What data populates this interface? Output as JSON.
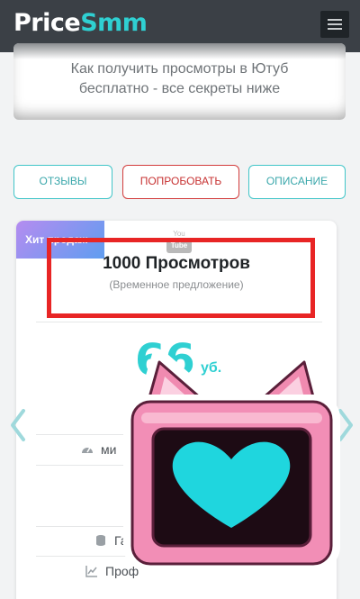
{
  "header": {
    "logo_part1": "Price",
    "logo_part2": "Smm"
  },
  "info": {
    "line1": "Как получить просмотры в Ютуб",
    "line2": "бесплатно - все секреты ниже"
  },
  "tabs": [
    {
      "label": "ОТЗЫВЫ"
    },
    {
      "label": "ПОПРОБОВАТЬ"
    },
    {
      "label": "ОПИСАНИЕ"
    }
  ],
  "product": {
    "badge": "Хит продаж",
    "icon_top": "You",
    "icon_bottom": "Tube",
    "title": "1000 Просмотров",
    "subtitle": "(Временное предложение)",
    "price": "66",
    "currency": "уб.",
    "features": [
      {
        "icon": "speedometer-icon",
        "label": "ми"
      },
      {
        "icon": "database-icon",
        "label": "Га"
      },
      {
        "icon": "chart-icon",
        "label": "Проф"
      }
    ]
  },
  "colors": {
    "accent": "#2fd0d2",
    "header_bg": "#3b4046",
    "active_tab": "#d23b3b",
    "highlight": "#e82525"
  }
}
